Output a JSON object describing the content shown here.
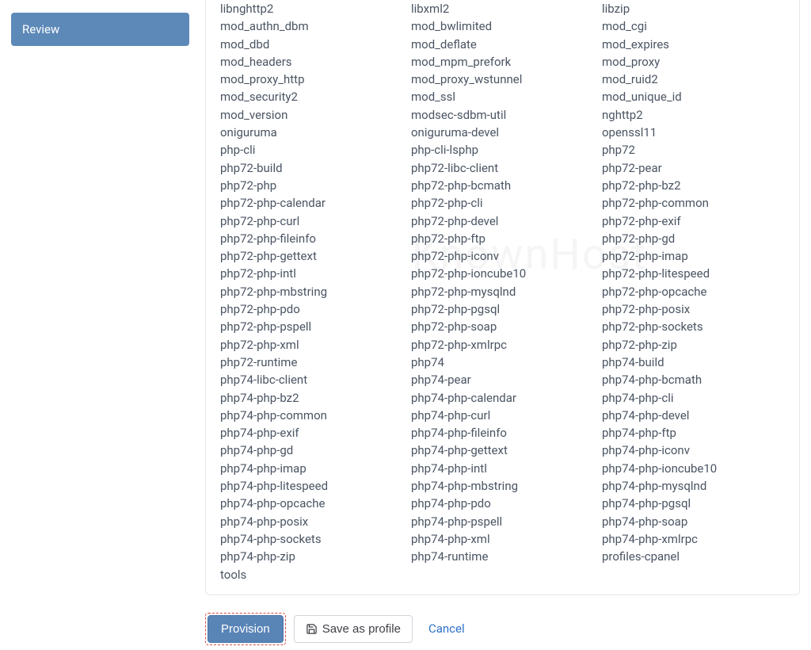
{
  "sidebar": {
    "review_label": "Review"
  },
  "actions": {
    "provision_label": "Provision",
    "save_profile_label": "Save as profile",
    "cancel_label": "Cancel"
  },
  "watermark": "KnownHost",
  "packages": {
    "col1": [
      "libnghttp2",
      "mod_authn_dbm",
      "mod_dbd",
      "mod_headers",
      "mod_proxy_http",
      "mod_security2",
      "mod_version",
      "oniguruma",
      "php-cli",
      "php72-build",
      "php72-php",
      "php72-php-calendar",
      "php72-php-curl",
      "php72-php-fileinfo",
      "php72-php-gettext",
      "php72-php-intl",
      "php72-php-mbstring",
      "php72-php-pdo",
      "php72-php-pspell",
      "php72-php-xml",
      "php72-runtime",
      "php74-libc-client",
      "php74-php-bz2",
      "php74-php-common",
      "php74-php-exif",
      "php74-php-gd",
      "php74-php-imap",
      "php74-php-litespeed",
      "php74-php-opcache",
      "php74-php-posix",
      "php74-php-sockets",
      "php74-php-zip",
      "tools"
    ],
    "col2": [
      "libxml2",
      "mod_bwlimited",
      "mod_deflate",
      "mod_mpm_prefork",
      "mod_proxy_wstunnel",
      "mod_ssl",
      "modsec-sdbm-util",
      "oniguruma-devel",
      "php-cli-lsphp",
      "php72-libc-client",
      "php72-php-bcmath",
      "php72-php-cli",
      "php72-php-devel",
      "php72-php-ftp",
      "php72-php-iconv",
      "php72-php-ioncube10",
      "php72-php-mysqlnd",
      "php72-php-pgsql",
      "php72-php-soap",
      "php72-php-xmlrpc",
      "php74",
      "php74-pear",
      "php74-php-calendar",
      "php74-php-curl",
      "php74-php-fileinfo",
      "php74-php-gettext",
      "php74-php-intl",
      "php74-php-mbstring",
      "php74-php-pdo",
      "php74-php-pspell",
      "php74-php-xml",
      "php74-runtime"
    ],
    "col3": [
      "libzip",
      "mod_cgi",
      "mod_expires",
      "mod_proxy",
      "mod_ruid2",
      "mod_unique_id",
      "nghttp2",
      "openssl11",
      "php72",
      "php72-pear",
      "php72-php-bz2",
      "php72-php-common",
      "php72-php-exif",
      "php72-php-gd",
      "php72-php-imap",
      "php72-php-litespeed",
      "php72-php-opcache",
      "php72-php-posix",
      "php72-php-sockets",
      "php72-php-zip",
      "php74-build",
      "php74-php-bcmath",
      "php74-php-cli",
      "php74-php-devel",
      "php74-php-ftp",
      "php74-php-iconv",
      "php74-php-ioncube10",
      "php74-php-mysqlnd",
      "php74-php-pgsql",
      "php74-php-soap",
      "php74-php-xmlrpc",
      "profiles-cpanel"
    ]
  }
}
